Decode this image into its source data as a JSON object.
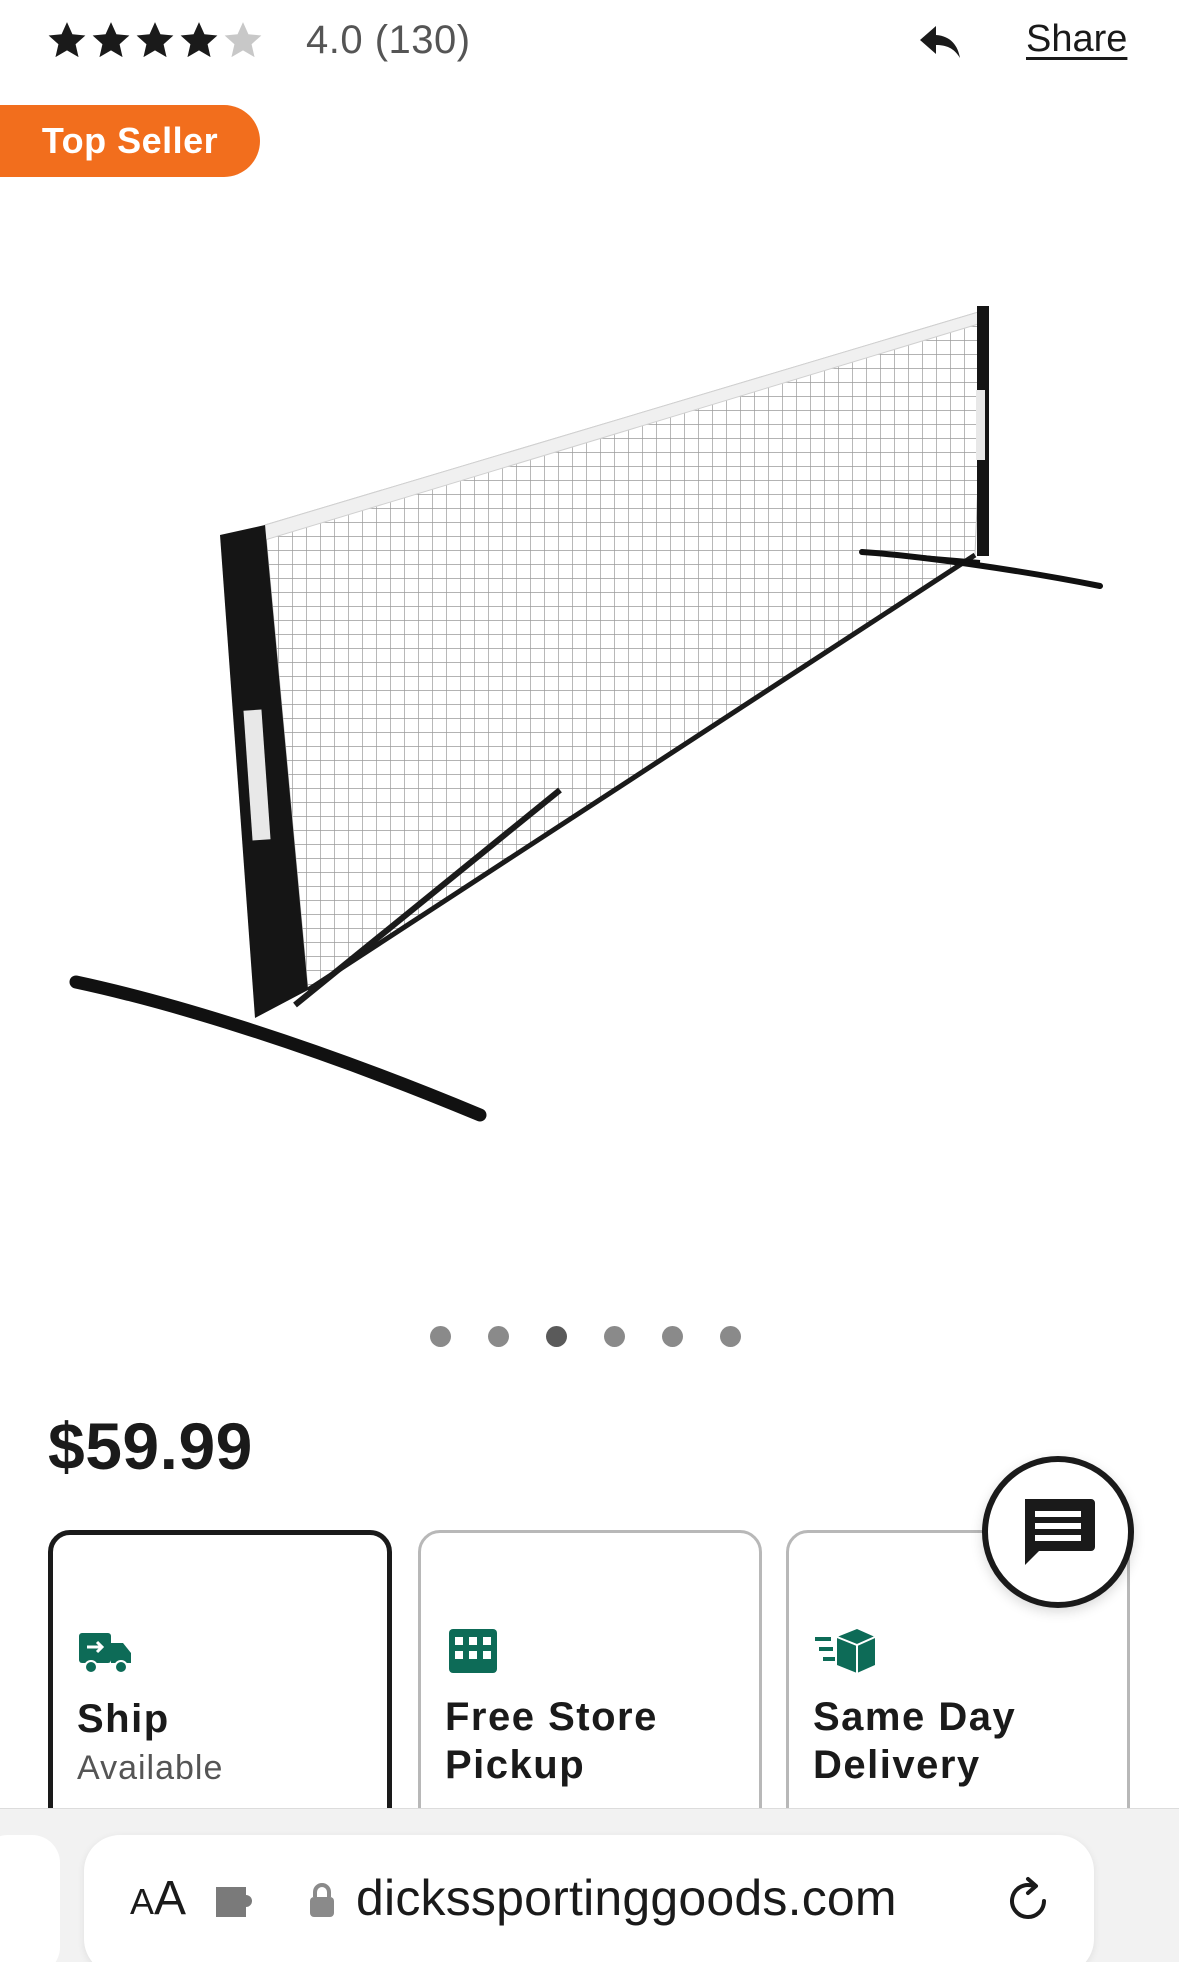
{
  "rating": {
    "stars_filled": 4,
    "stars_total": 5,
    "text": "4.0  (130)"
  },
  "share": {
    "label": "Share",
    "icon": "reply-arrow-icon"
  },
  "badge": {
    "label": "Top Seller",
    "color": "#f26e1d"
  },
  "product": {
    "image": "pickleball-net-image"
  },
  "carousel": {
    "total": 6,
    "active_index": 2
  },
  "price": "$59.99",
  "fulfillment": [
    {
      "title": "Ship",
      "subtitle": "Available",
      "icon": "delivery-truck-icon",
      "selected": true
    },
    {
      "title": "Free Store Pickup",
      "subtitle": "",
      "icon": "store-icon",
      "selected": false
    },
    {
      "title": "Same Day Delivery",
      "subtitle": "",
      "icon": "fast-box-icon",
      "selected": false
    }
  ],
  "accent_color": "#0d6b57",
  "chat": {
    "icon": "chat-bubble-icon"
  },
  "browser": {
    "aa_small": "A",
    "aa_big": "A",
    "url": "dickssportinggoods.com",
    "extension_icon": "puzzle-icon",
    "lock_icon": "lock-icon",
    "reload_icon": "reload-icon"
  }
}
